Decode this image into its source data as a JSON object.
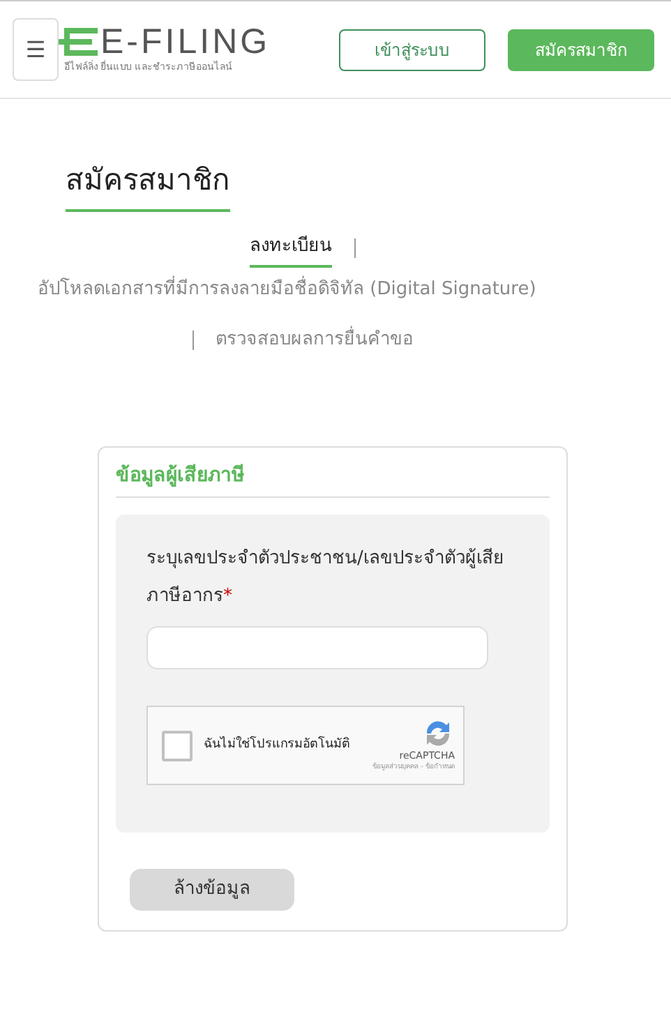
{
  "header": {
    "menu_glyph": "☰",
    "logo_title": "E-FILING",
    "logo_subtitle": "อีไฟล์ลิ่ง ยื่นแบบ และชำระภาษีออนไลน์",
    "buttons": [
      {
        "label": "เข้าสู่ระบบ",
        "kind": "outline"
      },
      {
        "label": "สมัครสมาชิก",
        "kind": "solid"
      }
    ]
  },
  "page_title": "สมัครสมาชิก",
  "tabs": [
    {
      "label": "ลงทะเบียน",
      "selected": true
    },
    {
      "label": "อัปโหลดเอกสารที่มีการลงลายมือชื่อดิจิทัล (Digital Signature)",
      "selected": false
    },
    {
      "label": "ตรวจสอบผลการยื่นคำขอ",
      "selected": false
    }
  ],
  "form": {
    "section_title": "ข้อมูลผู้เสียภาษี",
    "field_label": "ระบุเลขประจำตัวประชาชน/เลขประจำตัวผู้เสียภาษีอากร",
    "required_mark": "*",
    "captcha": {
      "label": "ฉันไม่ใช่โปรแกรมอัตโนมัติ",
      "checked": false,
      "brand": "reCAPTCHA",
      "links": "ข้อมูลส่วนบุคคล - ข้อกำหนด"
    },
    "clear_button": "ล้างข้อมูล"
  }
}
